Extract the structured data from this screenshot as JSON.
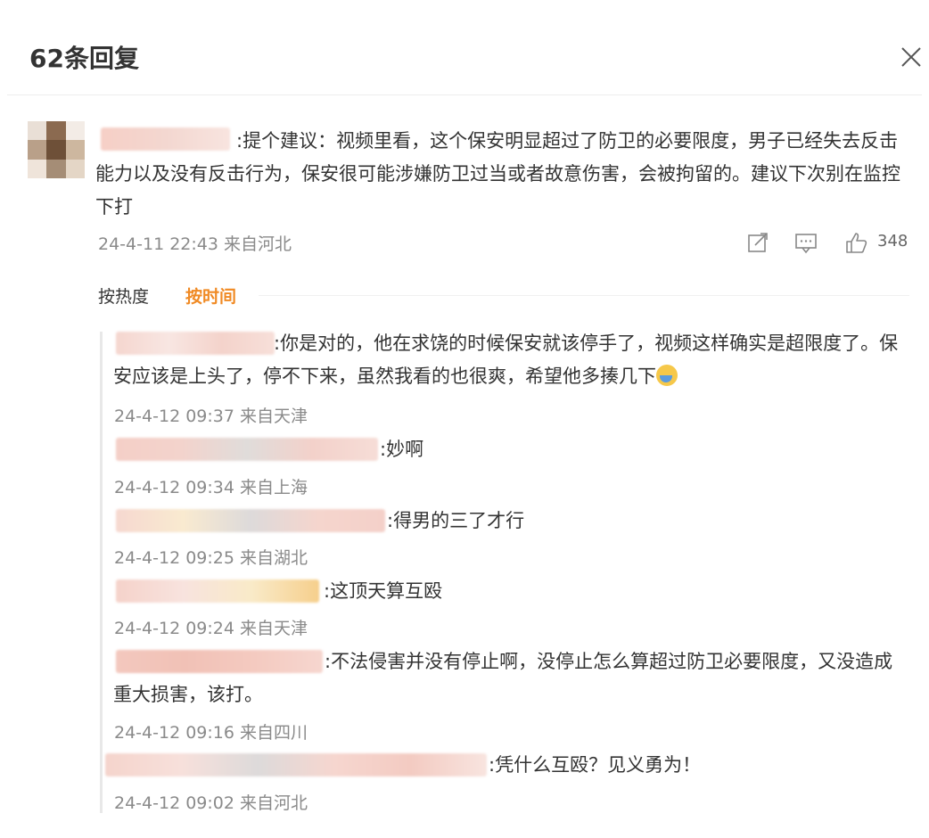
{
  "header": {
    "title": "62条回复"
  },
  "main_comment": {
    "text": ":提个建议：视频里看，这个保安明显超过了防卫的必要限度，男子已经失去反击能力以及没有反击行为，保安很可能涉嫌防卫过当或者故意伤害，会被拘留的。建议下次别在监控下打",
    "meta": "24-4-11 22:43 来自河北",
    "likes": "348",
    "icons": [
      "share-icon",
      "comment-icon",
      "like-icon"
    ]
  },
  "sort": {
    "hot_label": "按热度",
    "time_label": "按时间",
    "active_color": "#f08a24"
  },
  "replies": [
    {
      "text": ":你是对的，他在求饶的时候保安就该停手了，视频这样确实是超限度了。保安应该是上头了，停不下来，虽然我看的也很爽，希望他多揍几下",
      "meta": "24-4-12 09:37 来自天津",
      "has_emoji": true
    },
    {
      "text": ":妙啊",
      "meta": "24-4-12 09:34 来自上海"
    },
    {
      "text": ":得男的三了才行",
      "meta": "24-4-12 09:25 来自湖北"
    },
    {
      "text": ":这顶天算互殴",
      "meta": "24-4-12 09:24 来自天津"
    },
    {
      "text": ":不法侵害并没有停止啊，没停止怎么算超过防卫必要限度，又没造成重大损害，该打。",
      "meta": "24-4-12 09:16 来自四川"
    },
    {
      "text": ":凭什么互殴？见义勇为！",
      "meta": "24-4-12 09:02 来自河北"
    }
  ]
}
